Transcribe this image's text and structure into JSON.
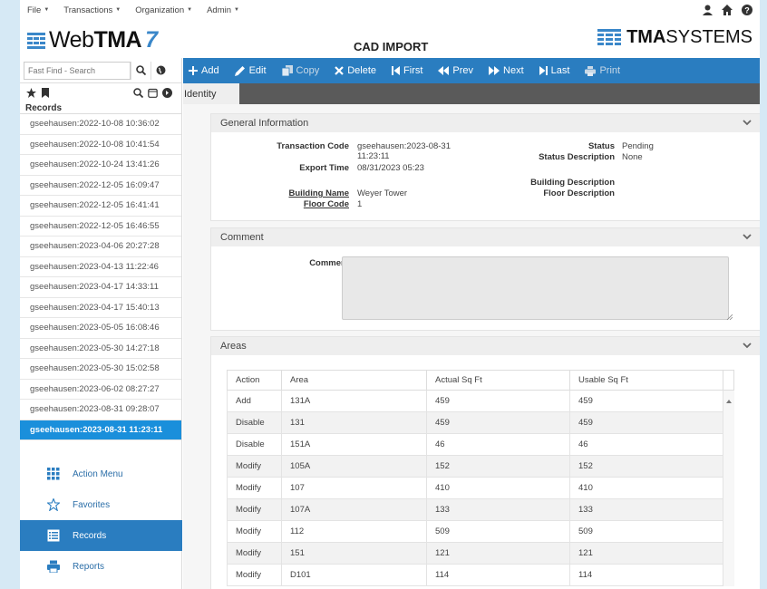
{
  "menubar": {
    "items": [
      "File",
      "Transactions",
      "Organization",
      "Admin"
    ]
  },
  "header": {
    "logo_web": "Web",
    "logo_tma": "TMA",
    "logo_seven": "7",
    "page_title": "CAD IMPORT",
    "brand_bold": "TMA",
    "brand_rest": "SYSTEMS"
  },
  "sidebar": {
    "search_placeholder": "Fast Find - Search",
    "records_header": "Records",
    "records": [
      "gseehausen:2022-10-08 10:36:02",
      "gseehausen:2022-10-08 10:41:54",
      "gseehausen:2022-10-24 13:41:26",
      "gseehausen:2022-12-05 16:09:47",
      "gseehausen:2022-12-05 16:41:41",
      "gseehausen:2022-12-05 16:46:55",
      "gseehausen:2023-04-06 20:27:28",
      "gseehausen:2023-04-13 11:22:46",
      "gseehausen:2023-04-17 14:33:11",
      "gseehausen:2023-04-17 15:40:13",
      "gseehausen:2023-05-05 16:08:46",
      "gseehausen:2023-05-30 14:27:18",
      "gseehausen:2023-05-30 15:02:58",
      "gseehausen:2023-06-02 08:27:27",
      "gseehausen:2023-08-31 09:28:07",
      "gseehausen:2023-08-31 11:23:11"
    ],
    "selected_index": 15,
    "nav": {
      "action_menu": "Action Menu",
      "favorites": "Favorites",
      "records": "Records",
      "reports": "Reports"
    }
  },
  "toolbar": {
    "add": "Add",
    "edit": "Edit",
    "copy": "Copy",
    "delete": "Delete",
    "first": "First",
    "prev": "Prev",
    "next": "Next",
    "last": "Last",
    "print": "Print"
  },
  "tabs": {
    "identity": "Identity"
  },
  "general": {
    "title": "General Information",
    "transaction_code_label": "Transaction Code",
    "transaction_code_line1": "gseehausen:2023-08-31",
    "transaction_code_line2": "11:23:11",
    "export_time_label": "Export Time",
    "export_time": "08/31/2023 05:23",
    "building_name_label": "Building Name",
    "building_name": "Weyer Tower",
    "floor_code_label": "Floor Code",
    "floor_code": "1",
    "status_label": "Status",
    "status": "Pending",
    "status_desc_label": "Status Description",
    "status_desc": "None",
    "building_desc_label": "Building Description",
    "floor_desc_label": "Floor Description"
  },
  "comment": {
    "title": "Comment",
    "label": "Comment",
    "value": ""
  },
  "areas": {
    "title": "Areas",
    "columns": [
      "Action",
      "Area",
      "Actual Sq Ft",
      "Usable Sq Ft"
    ],
    "rows": [
      [
        "Add",
        "131A",
        "459",
        "459"
      ],
      [
        "Disable",
        "131",
        "459",
        "459"
      ],
      [
        "Disable",
        "151A",
        "46",
        "46"
      ],
      [
        "Modify",
        "105A",
        "152",
        "152"
      ],
      [
        "Modify",
        "107",
        "410",
        "410"
      ],
      [
        "Modify",
        "107A",
        "133",
        "133"
      ],
      [
        "Modify",
        "112",
        "509",
        "509"
      ],
      [
        "Modify",
        "151",
        "121",
        "121"
      ],
      [
        "Modify",
        "D101",
        "114",
        "114"
      ]
    ]
  },
  "colors": {
    "accent": "#2a7dc0",
    "selected": "#1a8fdb",
    "tabbar": "#5a5a5a"
  }
}
